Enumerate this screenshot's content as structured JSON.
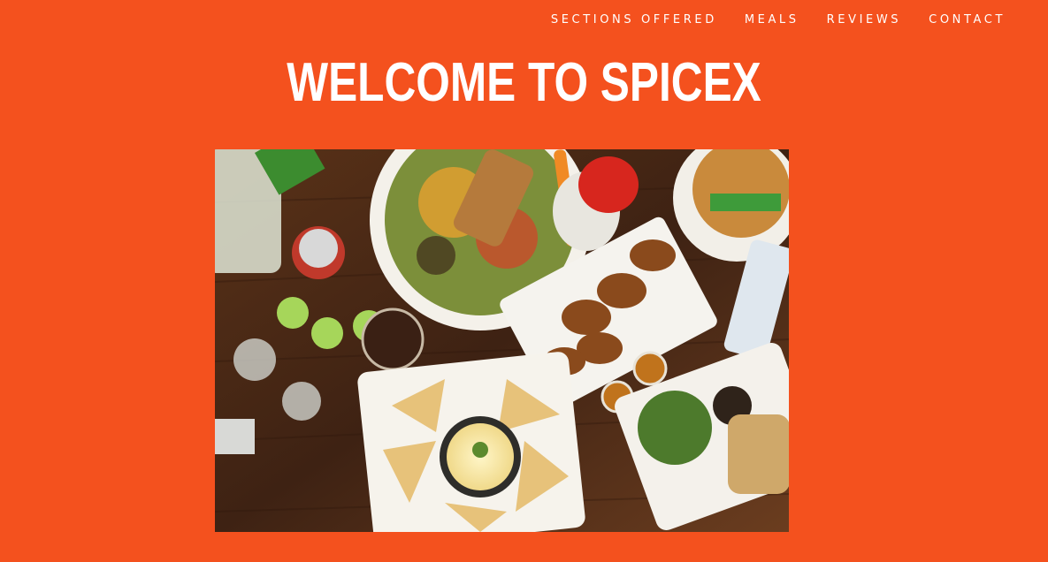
{
  "nav": {
    "items": [
      "SECTIONS OFFERED",
      "MEALS",
      "REVIEWS",
      "CONTACT"
    ]
  },
  "hero": {
    "title": "WELCOME TO SPICEX"
  },
  "colors": {
    "background": "#f4511e",
    "text": "#ffffff",
    "table_wood": "#4a2a18"
  }
}
